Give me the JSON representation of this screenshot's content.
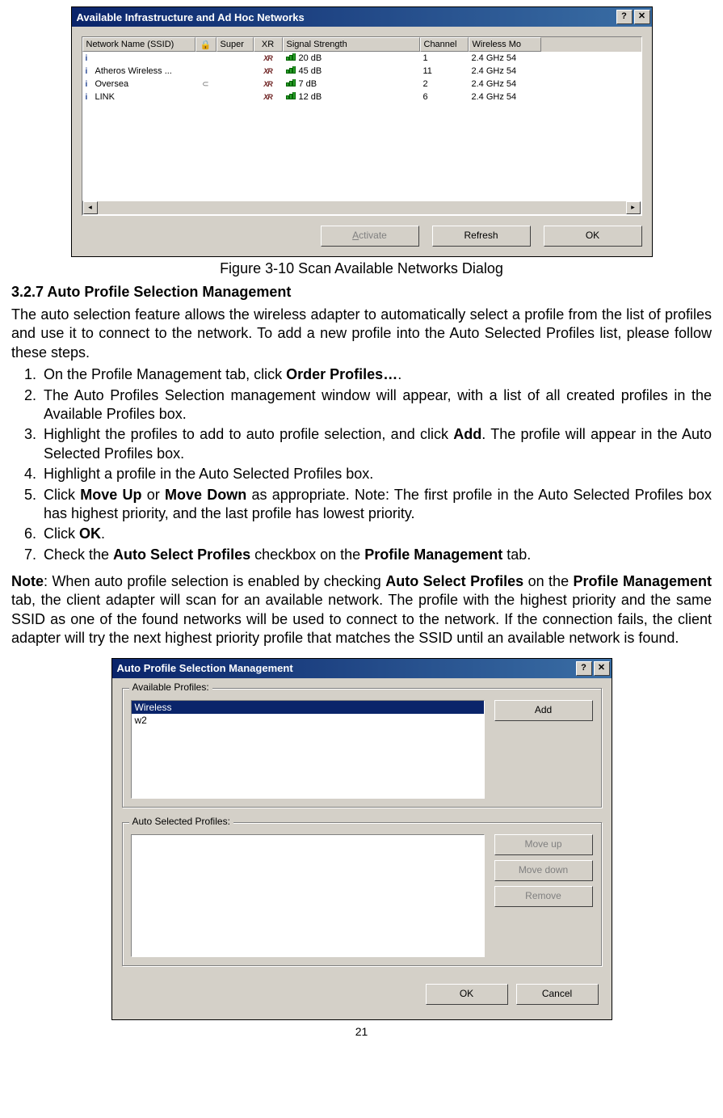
{
  "scanDialog": {
    "title": "Available Infrastructure and Ad Hoc Networks",
    "columns": [
      "Network Name (SSID)",
      "",
      "Super",
      "XR",
      "Signal Strength",
      "Channel",
      "Wireless Mo"
    ],
    "rows": [
      {
        "name": "",
        "lock": false,
        "xr": true,
        "signal": "20 dB",
        "channel": "1",
        "mode": "2.4 GHz 54"
      },
      {
        "name": "Atheros Wireless ...",
        "lock": false,
        "xr": true,
        "signal": "45 dB",
        "channel": "11",
        "mode": "2.4 GHz 54"
      },
      {
        "name": "Oversea",
        "lock": true,
        "xr": true,
        "signal": "7 dB",
        "channel": "2",
        "mode": "2.4 GHz 54"
      },
      {
        "name": "LINK",
        "lock": false,
        "xr": true,
        "signal": "12 dB",
        "channel": "6",
        "mode": "2.4 GHz 54"
      }
    ],
    "buttons": {
      "activate": "Activate",
      "refresh": "Refresh",
      "ok": "OK"
    }
  },
  "caption1": "Figure 3-10 Scan Available Networks Dialog",
  "heading": "3.2.7 Auto Profile Selection Management",
  "intro": "The auto selection feature allows the wireless adapter to automatically select a profile from the list of profiles and use it to connect to the network. To add a new profile into the Auto Selected Profiles list, please follow these steps.",
  "steps": {
    "s1a": "On the Profile Management tab, click ",
    "s1b": "Order Profiles…",
    "s1c": ".",
    "s2": "The Auto Profiles Selection management window will appear, with a list of all created profiles in the Available Profiles box.",
    "s3a": "Highlight the profiles to add to auto profile selection, and click ",
    "s3b": "Add",
    "s3c": ". The profile will appear in the Auto Selected Profiles box.",
    "s4": "Highlight a profile in the Auto Selected Profiles box.",
    "s5a": "Click ",
    "s5b": "Move Up",
    "s5c": " or ",
    "s5d": "Move Down",
    "s5e": " as appropriate. Note: The first profile in the Auto Selected Profiles box has highest priority, and the last profile has lowest priority.",
    "s6a": "Click ",
    "s6b": "OK",
    "s6c": ".",
    "s7a": "Check the ",
    "s7b": "Auto Select Profiles",
    "s7c": " checkbox on the ",
    "s7d": "Profile Management",
    "s7e": " tab."
  },
  "note": {
    "label": "Note",
    "a": ": When auto profile selection is enabled by checking ",
    "b": "Auto Select Profiles",
    "c": " on the ",
    "d": "Profile Management",
    "e": " tab, the client adapter will scan for an available network. The profile with the highest priority and the same SSID as one of the found networks will be used to connect to the network. If the connection fails, the client adapter will try the next highest priority profile that matches the SSID until an available network is found."
  },
  "autoDialog": {
    "title": "Auto Profile Selection Management",
    "group1": "Available Profiles:",
    "group2": "Auto Selected Profiles:",
    "availableItems": [
      "Wireless",
      "w2"
    ],
    "buttons": {
      "add": "Add",
      "moveup": "Move up",
      "movedown": "Move down",
      "remove": "Remove",
      "ok": "OK",
      "cancel": "Cancel"
    }
  },
  "pageNumber": "21"
}
